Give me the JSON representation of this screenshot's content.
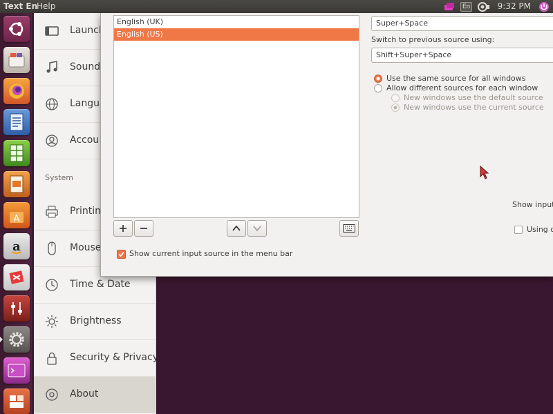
{
  "top_panel": {
    "app_title": "Text En",
    "help_menu": "Help",
    "keyboard_indicator": "En",
    "time": "9:32 PM"
  },
  "launcher": {
    "items": [
      {
        "name": "dash-home-icon"
      },
      {
        "name": "files-icon"
      },
      {
        "name": "firefox-icon"
      },
      {
        "name": "libreoffice-writer-icon"
      },
      {
        "name": "libreoffice-calc-icon"
      },
      {
        "name": "libreoffice-impress-icon"
      },
      {
        "name": "ubuntu-software-center-icon"
      },
      {
        "name": "amazon-icon"
      },
      {
        "name": "bug-app-icon"
      },
      {
        "name": "sound-mixer-icon"
      },
      {
        "name": "system-settings-icon"
      },
      {
        "name": "terminal-icon"
      },
      {
        "name": "keyboard-layout-icon"
      }
    ]
  },
  "sidebar": {
    "items": [
      {
        "label": "Launch",
        "icon": "launcher-icon"
      },
      {
        "label": "Sound",
        "icon": "music-note-icon"
      },
      {
        "label": "Langua",
        "icon": "globe-icon"
      },
      {
        "label": "Accou",
        "icon": "user-icon"
      }
    ],
    "system_heading": "System",
    "system_items": [
      {
        "label": "Printin",
        "icon": "printer-icon"
      },
      {
        "label": "Mouse",
        "icon": "mouse-icon"
      },
      {
        "label": "Time & Date",
        "icon": "clock-icon"
      },
      {
        "label": "Brightness",
        "icon": "brightness-icon"
      },
      {
        "label": "Security & Privacy",
        "icon": "lock-icon"
      },
      {
        "label": "About",
        "icon": "info-icon"
      }
    ],
    "selected": "About"
  },
  "dialog": {
    "sources": [
      "English (UK)",
      "English (US)"
    ],
    "selected_source": "English (US)",
    "show_in_menu_bar_label": "Show current input source in the menu bar",
    "show_in_menu_bar_checked": true,
    "next_shortcut_value": "Super+Space",
    "prev_shortcut_label": "Switch to previous source using:",
    "prev_shortcut_value": "Shift+Super+Space",
    "radio_same_label": "Use the same source for all windows",
    "radio_different_label": "Allow different sources for each window",
    "radio_default_label": "New windows use the default source",
    "radio_current_label": "New windows use the current source",
    "show_input_label": "Show input c",
    "using_label": "Using cu"
  }
}
